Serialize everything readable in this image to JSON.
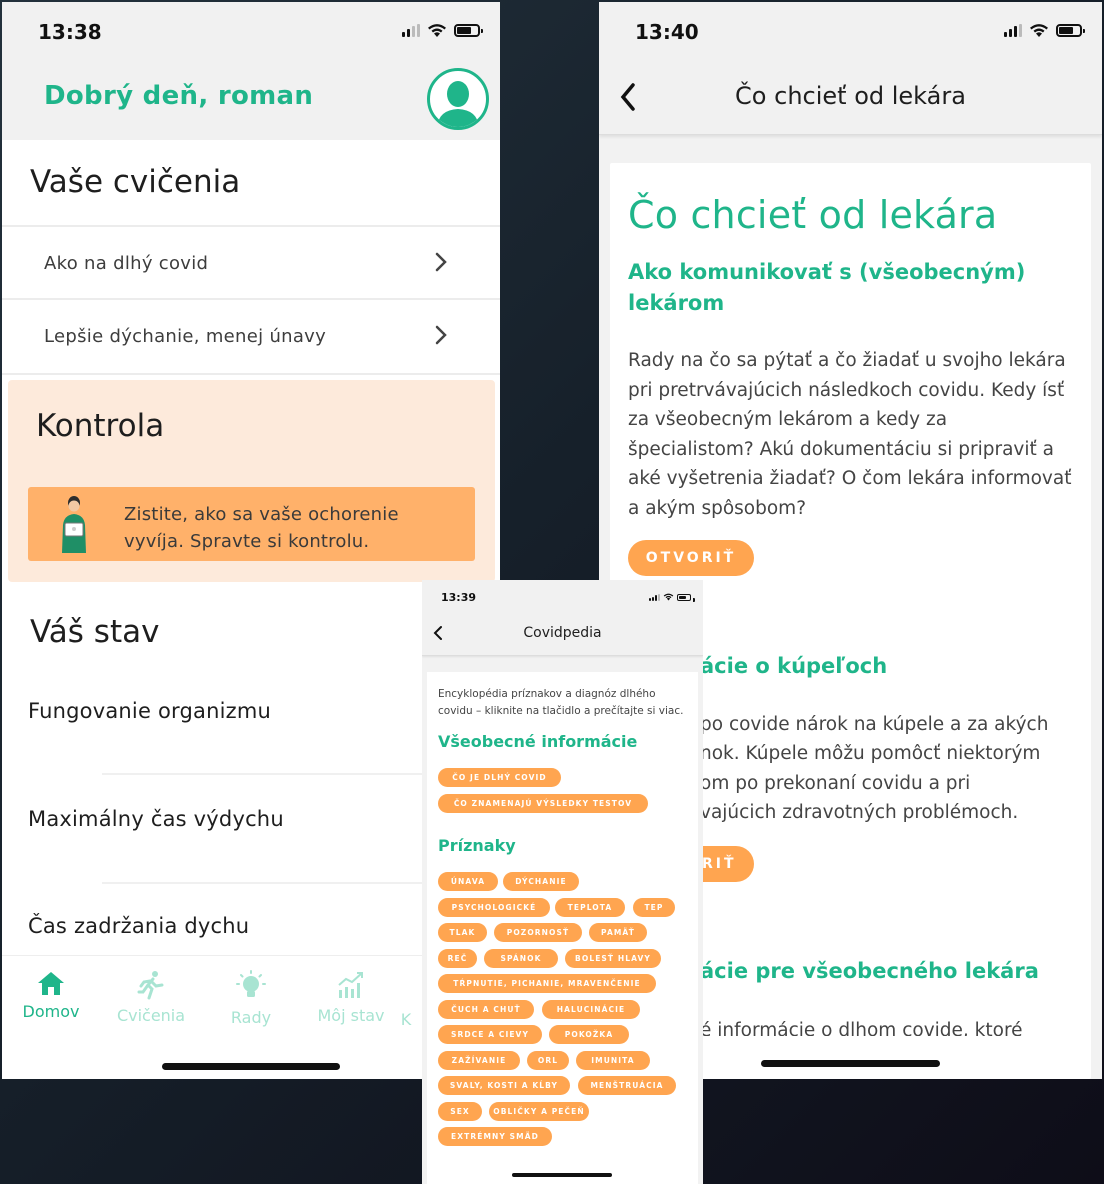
{
  "status_bar": {
    "phone1_time": "13:38",
    "phone2_time": "13:40",
    "phone3_time": "13:39"
  },
  "home_screen": {
    "greeting": "Dobrý deň, roman",
    "exercises_title": "Vaše cvičenia",
    "exercises": [
      {
        "label": "Ako na dlhý covid"
      },
      {
        "label": "Lepšie dýchanie, menej únavy"
      }
    ],
    "kontrola": {
      "title": "Kontrola",
      "banner_text": "Zistite, ako sa vaše ochorenie vyvíja. Spravte si kontrolu."
    },
    "status_title": "Váš stav",
    "status_items": [
      {
        "label": "Fungovanie organizmu"
      },
      {
        "label": "Maximálny čas výdychu"
      },
      {
        "label": "Čas zadržania dychu"
      }
    ],
    "tabs": [
      {
        "label": "Domov",
        "icon": "home-icon",
        "active": true
      },
      {
        "label": "Cvičenia",
        "icon": "running-icon",
        "active": false
      },
      {
        "label": "Rady",
        "icon": "lightbulb-icon",
        "active": false
      },
      {
        "label": "Môj stav",
        "icon": "chart-icon",
        "active": false
      },
      {
        "label": "K",
        "icon": "",
        "active": false
      }
    ]
  },
  "article_screen": {
    "nav_title": "Čo chcieť od lekára",
    "heading": "Čo chcieť od lekára",
    "section1_title": "Ako komunikovať s (všeobecným) lekárom",
    "section1_text": "Rady na čo sa pýtať a čo žiadať u svojho lekára pri pretrvávajúcich následkoch covidu. Kedy ísť za všeobecným lekárom a kedy za špecialistom? Akú dokumentáciu si pripraviť a aké vyšetrenia žiadať? O čom lekára informovať a akým spôsobom?",
    "open_button": "OTVORIŤ",
    "section2_title_partial": "ácie o kúpeľoch",
    "section2_lines": [
      "po covide nárok na kúpele a za akých",
      "nok. Kúpele môžu pomôcť niektorým",
      "om po prekonaní covidu a pri",
      "vajúcich zdravotných problémoch."
    ],
    "open_button_partial": "RIŤ",
    "section3_title_partial": "ácie pre všeobecného lekára",
    "section3_text_partial": "é informácie o dlhom covide, ktoré"
  },
  "covidpedia_screen": {
    "nav_title": "Covidpedia",
    "intro": "Encyklopédia príznakov a diagnóz dlhého covidu – kliknite na tlačidlo a prečítajte si viac.",
    "general_title": "Všeobecné informácie",
    "general_tags": [
      "ČO JE DLHÝ COVID",
      "ČO ZNAMENAJÚ VÝSLEDKY TESTOV"
    ],
    "symptoms_title": "Príznaky",
    "symptom_tags": [
      "ÚNAVA",
      "DÝCHANIE",
      "PSYCHOLOGICKÉ",
      "TEPLOTA",
      "TEP",
      "TLAK",
      "POZORNOSŤ",
      "PAMÄŤ",
      "REČ",
      "SPÁNOK",
      "BOLESŤ HLAVY",
      "TŔPNUTIE, PICHANIE, MRAVENČENIE",
      "ČUCH A CHUŤ",
      "HALUCINÁCIE",
      "SRDCE A CIEVY",
      "POKOŽKA",
      "ZAŽÍVANIE",
      "ORL",
      "IMUNITA",
      "SVALY, KOSTI A KĹBY",
      "MENŠTRUÁCIA",
      "SEX",
      "OBLIČKY A PEČEŇ",
      "EXTRÉMNY SMÄD"
    ]
  },
  "colors": {
    "accent_green": "#1fb58a",
    "accent_orange": "#ffa550",
    "kontrola_bg": "#fdeadb"
  }
}
